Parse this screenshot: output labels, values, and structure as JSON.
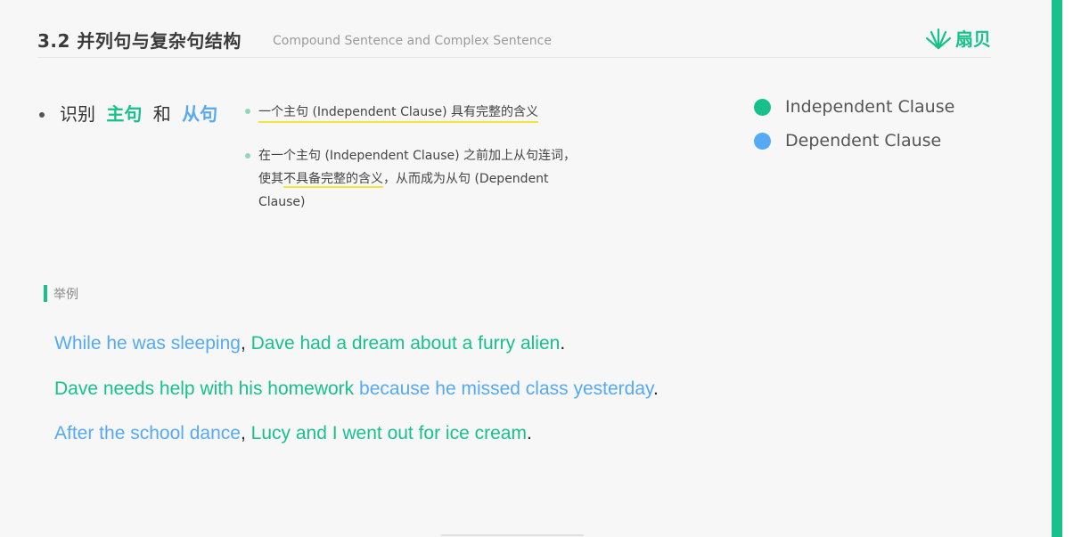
{
  "header": {
    "title": "3.2 并列句与复杂句结构",
    "subtitle": "Compound Sentence and Complex Sentence",
    "logo_text": "扇贝"
  },
  "identify": {
    "prefix": "识别",
    "main": "主句",
    "and": "和",
    "sub": "从句"
  },
  "points": {
    "p1_before": "",
    "p1_highlight": "一个主句 (Independent Clause) 具有完整的含义",
    "p2_before": "在一个主句 (Independent Clause) 之前加上从句连词，使其",
    "p2_highlight": "不具备完整的含义",
    "p2_after": "，从而成为从句 (Dependent Clause)"
  },
  "legend": {
    "independent": "Independent Clause",
    "dependent": "Dependent Clause"
  },
  "example": {
    "label": "举例",
    "s1": [
      {
        "text": "While he was sleeping",
        "color": "blue"
      },
      {
        "text": ", ",
        "color": "plain"
      },
      {
        "text": "Dave had a dream about a furry alien",
        "color": "green"
      },
      {
        "text": ".",
        "color": "plain"
      }
    ],
    "s2": [
      {
        "text": "Dave needs help with his homework",
        "color": "green"
      },
      {
        "text": " ",
        "color": "plain"
      },
      {
        "text": "because he missed class yesterday",
        "color": "blue"
      },
      {
        "text": ".",
        "color": "plain"
      }
    ],
    "s3": [
      {
        "text": "After the school dance",
        "color": "blue"
      },
      {
        "text": ", ",
        "color": "plain"
      },
      {
        "text": "Lucy and I went out for ice cream",
        "color": "green"
      },
      {
        "text": ".",
        "color": "plain"
      }
    ]
  },
  "colors": {
    "green": "#18c18c",
    "blue": "#56a9f5",
    "highlight": "#f2e63b"
  }
}
